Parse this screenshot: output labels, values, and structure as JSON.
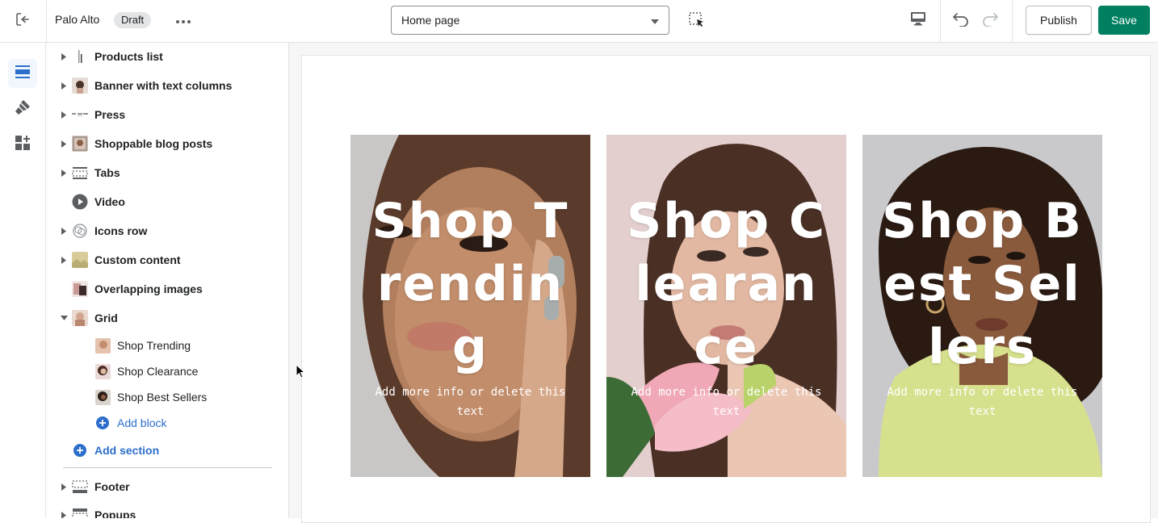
{
  "topbar": {
    "theme_name": "Palo Alto",
    "status_badge": "Draft",
    "page_select_value": "Home page",
    "publish_label": "Publish",
    "save_label": "Save",
    "icons": [
      "exit-icon",
      "more-horizontal-icon",
      "chevron-down-icon",
      "inspector-icon",
      "desktop-icon",
      "undo-icon",
      "redo-icon"
    ]
  },
  "rail": {
    "items": [
      {
        "icon": "sections-icon",
        "active": true
      },
      {
        "icon": "theme-settings-icon",
        "active": false
      },
      {
        "icon": "app-embeds-icon",
        "active": false
      }
    ]
  },
  "sidebar": {
    "sections": [
      {
        "label": "Products list",
        "expandable": true
      },
      {
        "label": "Banner with text columns",
        "expandable": true
      },
      {
        "label": "Press",
        "expandable": true
      },
      {
        "label": "Shoppable blog posts",
        "expandable": true
      },
      {
        "label": "Tabs",
        "expandable": true
      },
      {
        "label": "Video",
        "expandable": false
      },
      {
        "label": "Icons row",
        "expandable": true
      },
      {
        "label": "Custom content",
        "expandable": true
      },
      {
        "label": "Overlapping images",
        "expandable": false
      },
      {
        "label": "Grid",
        "expandable": true,
        "expanded": true
      }
    ],
    "grid_blocks": [
      {
        "label": "Shop Trending"
      },
      {
        "label": "Shop Clearance"
      },
      {
        "label": "Shop Best Sellers"
      }
    ],
    "add_block_label": "Add block",
    "add_section_label": "Add section",
    "footer_sections": [
      {
        "label": "Footer"
      },
      {
        "label": "Popups"
      }
    ]
  },
  "preview": {
    "cards": [
      {
        "title": "Shop Trending",
        "subtitle": "Add more info or delete this text"
      },
      {
        "title": "Shop Clearance",
        "subtitle": "Add more info or delete this text"
      },
      {
        "title": "Shop Best Sellers",
        "subtitle": "Add more info or delete this text"
      }
    ]
  },
  "colors": {
    "save_green": "#008060",
    "link_blue": "#2c6ecb",
    "active_rail_blue": "#2c6ecb"
  }
}
